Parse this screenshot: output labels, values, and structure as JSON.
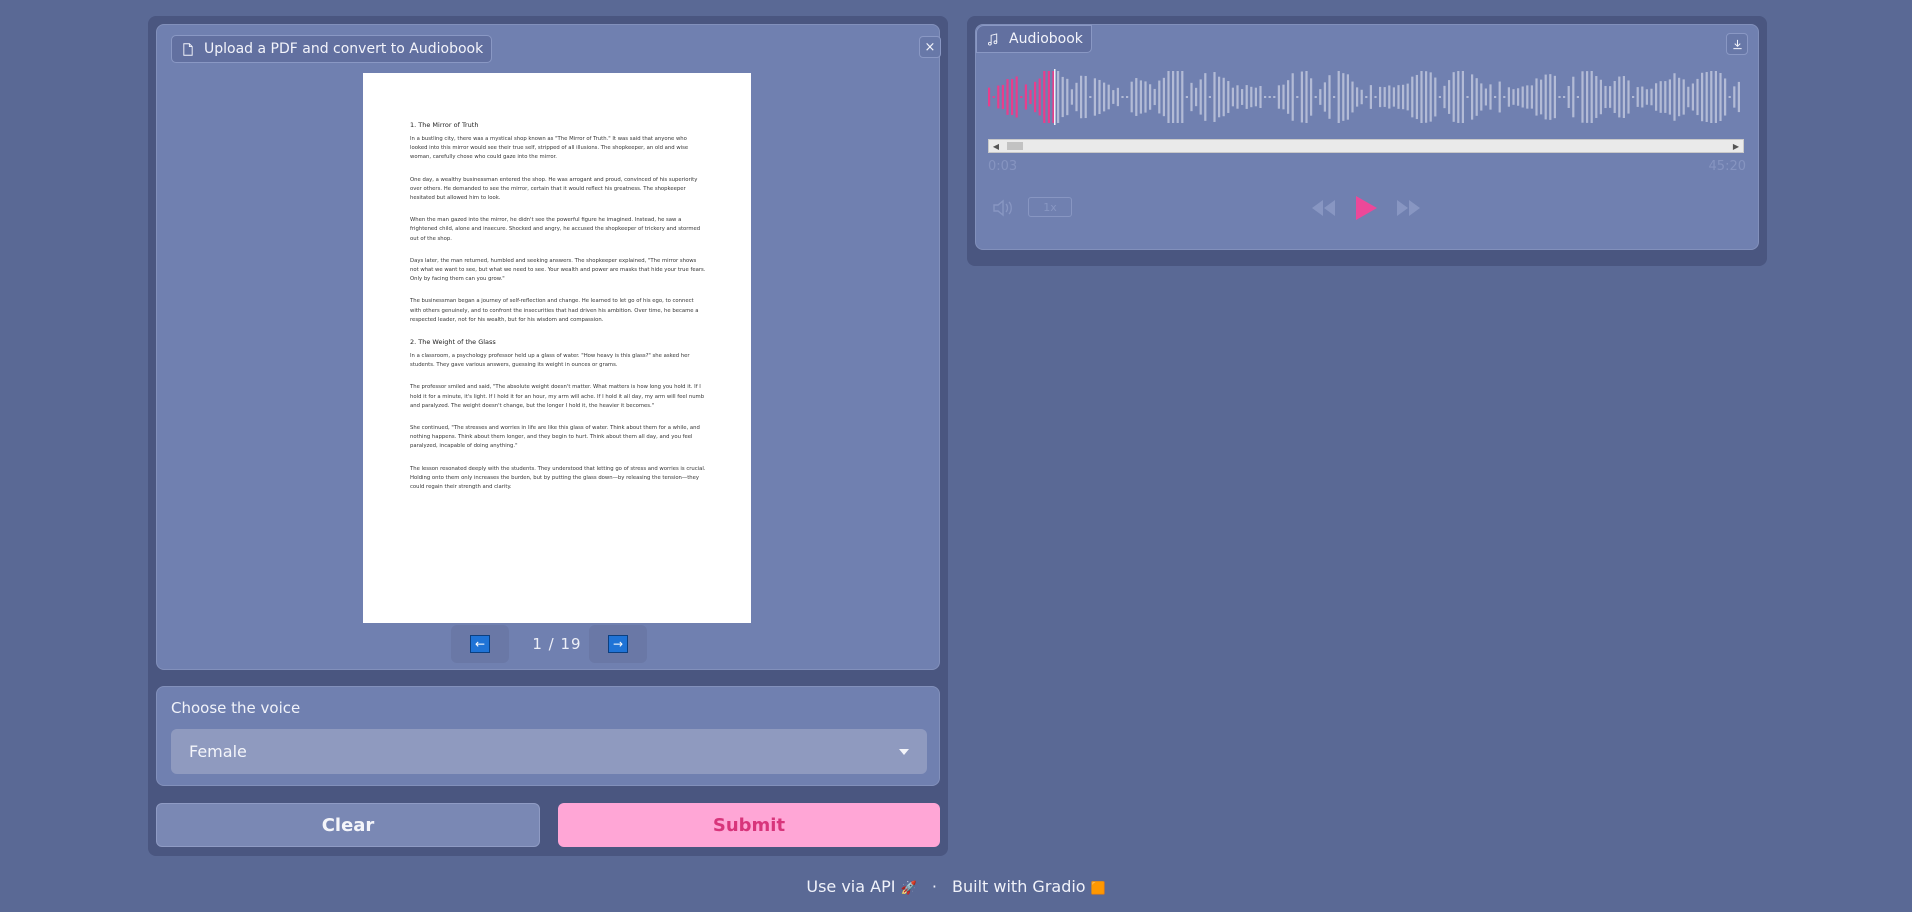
{
  "input": {
    "upload_label": "Upload a PDF and convert to Audiobook",
    "close_label": "×",
    "pdf": {
      "sections": [
        {
          "heading": "1. The Mirror of Truth",
          "paragraphs": [
            "In a bustling city, there was a mystical shop known as \"The Mirror of Truth.\" It was said that anyone who looked into this mirror would see their true self, stripped of all illusions. The shopkeeper, an old and wise woman, carefully chose who could gaze into the mirror.",
            "One day, a wealthy businessman entered the shop. He was arrogant and proud, convinced of his superiority over others. He demanded to see the mirror, certain that it would reflect his greatness. The shopkeeper hesitated but allowed him to look.",
            "When the man gazed into the mirror, he didn't see the powerful figure he imagined. Instead, he saw a frightened child, alone and insecure. Shocked and angry, he accused the shopkeeper of trickery and stormed out of the shop.",
            "Days later, the man returned, humbled and seeking answers. The shopkeeper explained, \"The mirror shows not what we want to see, but what we need to see. Your wealth and power are masks that hide your true fears. Only by facing them can you grow.\"",
            "The businessman began a journey of self-reflection and change. He learned to let go of his ego, to connect with others genuinely, and to confront the insecurities that had driven his ambition. Over time, he became a respected leader, not for his wealth, but for his wisdom and compassion."
          ]
        },
        {
          "heading": "2. The Weight of the Glass",
          "paragraphs": [
            "In a classroom, a psychology professor held up a glass of water. \"How heavy is this glass?\" she asked her students. They gave various answers, guessing its weight in ounces or grams.",
            "The professor smiled and said, \"The absolute weight doesn't matter. What matters is how long you hold it. If I hold it for a minute, it's light. If I hold it for an hour, my arm will ache. If I hold it all day, my arm will feel numb and paralyzed. The weight doesn't change, but the longer I hold it, the heavier it becomes.\"",
            "She continued, \"The stresses and worries in life are like this glass of water. Think about them for a while, and nothing happens. Think about them longer, and they begin to hurt. Think about them all day, and you feel paralyzed, incapable of doing anything.\"",
            "The lesson resonated deeply with the students. They understood that letting go of stress and worries is crucial. Holding onto them only increases the burden, but by putting the glass down—by releasing the tension—they could regain their strength and clarity."
          ]
        }
      ]
    },
    "pager": {
      "prev_symbol": "←",
      "next_symbol": "→",
      "page_text": "1 / 19"
    },
    "voice": {
      "label": "Choose the voice",
      "selected": "Female"
    },
    "clear_label": "Clear",
    "submit_label": "Submit"
  },
  "output": {
    "audio_label": "Audiobook",
    "current_time": "0:03",
    "duration": "45:20",
    "speed": "1x",
    "progress_fraction": 0.0011,
    "colors": {
      "played": "#e83e8c",
      "unplayed": "#b3bbd6",
      "accent": "#ec4899"
    }
  },
  "footer": {
    "api_text": "Use via API",
    "api_icon": "🚀",
    "dot": "·",
    "built_text": "Built with Gradio",
    "built_icon": "🟧"
  }
}
